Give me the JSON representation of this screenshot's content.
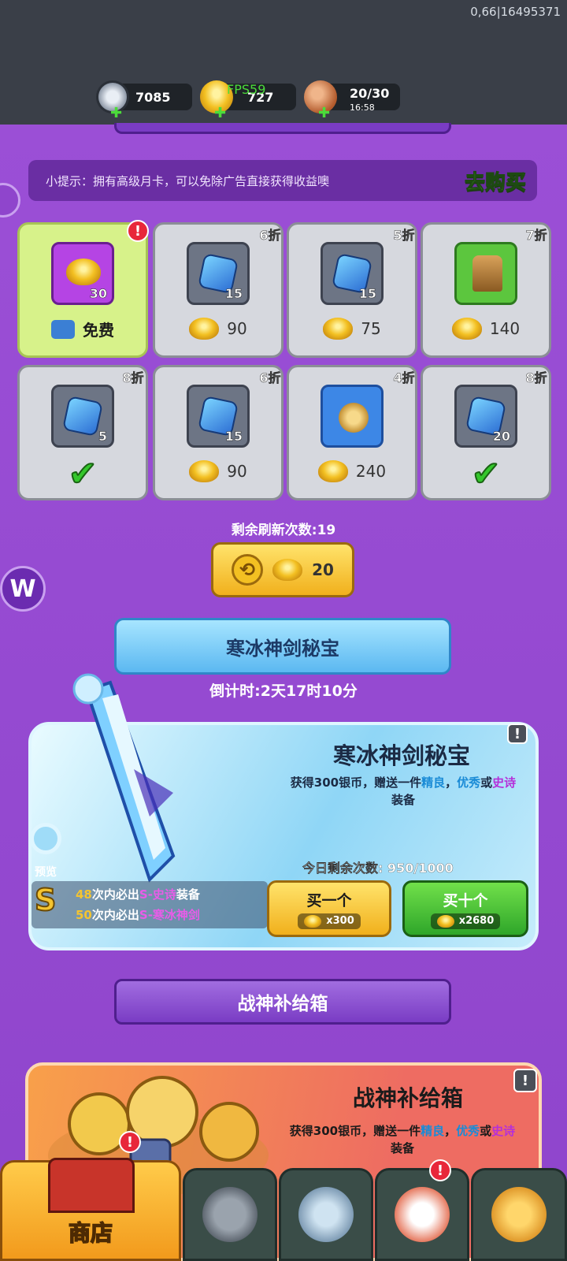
{
  "debug": "0,66|16495371",
  "resources": [
    {
      "name": "silver-coin",
      "value": "7085"
    },
    {
      "name": "gold-ingot",
      "value": "727",
      "overlay": "FPS59"
    },
    {
      "name": "stamina",
      "value": "20/30",
      "timer": "16:58"
    }
  ],
  "hint": {
    "text": "小提示：拥有高级月卡，可以免除广告直接获得收益噢",
    "action": "去购买"
  },
  "shop_items": [
    {
      "qty": "30",
      "price_label": "免费",
      "discount": "",
      "state": "free"
    },
    {
      "qty": "15",
      "price": "90",
      "discount": "6折"
    },
    {
      "qty": "15",
      "price": "75",
      "discount": "5折"
    },
    {
      "qty": "",
      "price": "140",
      "discount": "7折"
    },
    {
      "qty": "5",
      "price": "",
      "discount": "8折",
      "state": "bought"
    },
    {
      "qty": "15",
      "price": "90",
      "discount": "6折"
    },
    {
      "qty": "",
      "price": "240",
      "discount": "4折"
    },
    {
      "qty": "20",
      "price": "",
      "discount": "8折",
      "state": "bought"
    }
  ],
  "refresh": {
    "label": "剩余刷新次数:19",
    "cost": "20"
  },
  "side_badge": "W",
  "ice_event": {
    "banner": "寒冰神剑秘宝",
    "countdown": "倒计时:2天17时10分",
    "title": "寒冰神剑秘宝",
    "desc_prefix": "获得300银币，赠送一件",
    "desc_good": "精良",
    "desc_sep": "，",
    "desc_excellent": "优秀",
    "desc_or": "或",
    "desc_epic": "史诗",
    "desc_suffix": "装备",
    "remaining": "今日剩余次数: 950/1000",
    "preview": "预览",
    "pity1_num": "48",
    "pity1_text": "次内必出",
    "pity1_tag": "S-史诗",
    "pity1_end": "装备",
    "pity2_num": "50",
    "pity2_text": "次内必出",
    "pity2_tag": "S-寒冰神剑",
    "buy_one": "买一个",
    "buy_one_cost": "x300",
    "buy_ten": "买十个",
    "buy_ten_cost": "x2680"
  },
  "war_event": {
    "banner": "战神补给箱",
    "title": "战神补给箱",
    "desc_prefix": "获得300银币，赠送一件",
    "desc_good": "精良",
    "desc_sep": "，",
    "desc_excellent": "优秀",
    "desc_or": "或",
    "desc_epic": "史诗",
    "desc_suffix": "装备"
  },
  "nav": {
    "shop_label": "商店"
  },
  "colors": {
    "background": "#9b4fd6",
    "topbar": "#3a3f48",
    "accent_gold": "#f3c022",
    "accent_green": "#4bdc3a"
  }
}
